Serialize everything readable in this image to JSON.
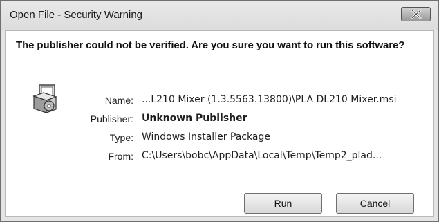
{
  "window": {
    "title": "Open File - Security Warning"
  },
  "dialog": {
    "headline": "The publisher could not be verified.  Are you sure you want to run this software?",
    "fields": [
      {
        "label": "Name:",
        "value": "...L210 Mixer (1.3.5563.13800)\\PLA DL210 Mixer.msi"
      },
      {
        "label": "Publisher:",
        "value": "Unknown Publisher"
      },
      {
        "label": "Type:",
        "value": "Windows Installer Package"
      },
      {
        "label": "From:",
        "value": "C:\\Users\\bobc\\AppData\\Local\\Temp\\Temp2_plad..."
      }
    ],
    "icon": "installer-package-icon"
  },
  "buttons": {
    "run_label": "Run",
    "cancel_label": "Cancel"
  },
  "colors": {
    "frame": "#e4e4e4",
    "close_button": "#9a9a9a"
  }
}
